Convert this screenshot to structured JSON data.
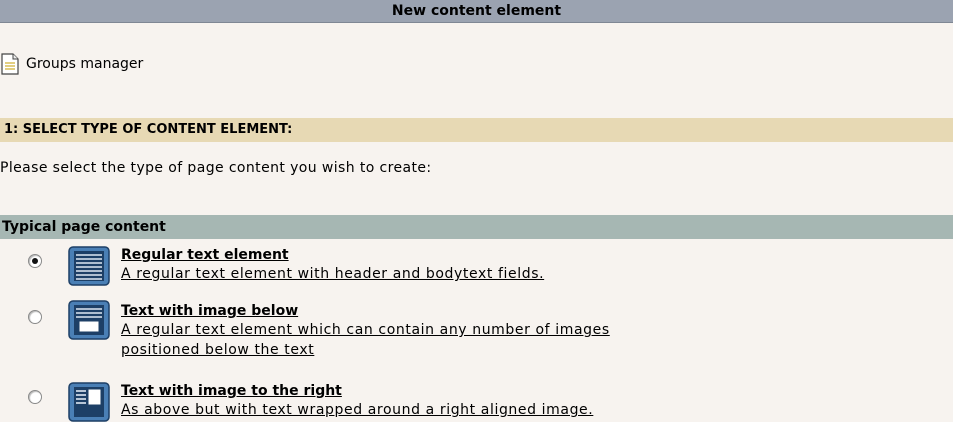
{
  "header": {
    "title": "New content element"
  },
  "record": {
    "icon": "page-icon",
    "label": "Groups manager"
  },
  "step": {
    "title": "1: SELECT TYPE OF CONTENT ELEMENT:"
  },
  "instructions": "Please select the type of page content you wish to create:",
  "group": {
    "title": "Typical page content"
  },
  "options": [
    {
      "selected": true,
      "icon": "regular-text-icon",
      "title": "Regular text element",
      "description": "A regular text element with header and bodytext fields."
    },
    {
      "selected": false,
      "icon": "text-image-below-icon",
      "title": "Text with image below",
      "description_line1": "A regular text element which can contain any number of images",
      "description_line2": "positioned below the text"
    },
    {
      "selected": false,
      "icon": "text-image-right-icon",
      "title": "Text with image to the right",
      "description": "As above but with text wrapped around a right aligned image."
    }
  ],
  "colors": {
    "background": "#f7f3ef",
    "title_bar": "#9ba3b1",
    "step_header": "#e7d9b4",
    "group_header": "#a6b7b3",
    "icon_fill": "#4a7fb5"
  }
}
